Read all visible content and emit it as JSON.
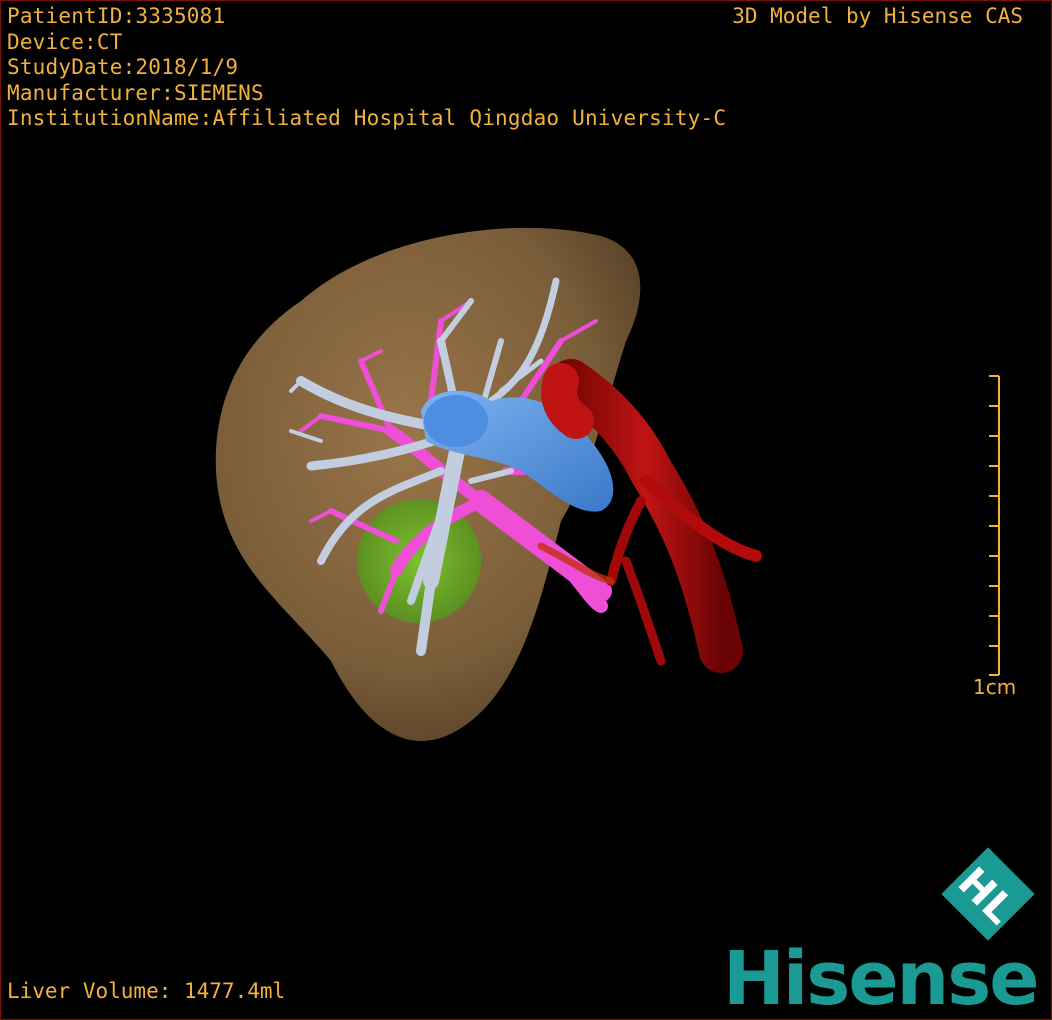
{
  "overlay": {
    "patient_id": "PatientID:3335081",
    "device": "Device:CT",
    "study_date": "StudyDate:2018/1/9",
    "manufacturer": "Manufacturer:SIEMENS",
    "institution": "InstitutionName:Affiliated Hospital Qingdao University-C",
    "credit": "3D Model by Hisense CAS",
    "liver_volume": "Liver Volume: 1477.4ml"
  },
  "scale_bar": {
    "label": "1cm",
    "color": "#f2b13a"
  },
  "brand": {
    "name": "Hisense",
    "logo_letters": "HL",
    "color": "#1a9a93"
  },
  "colors": {
    "text": "#f2b13a",
    "liver": "#8a6a43",
    "portal_vein": "#c3cde0",
    "hepatic_artery": "#ee4fd6",
    "ivc": "#5b9ae0",
    "aorta": "#b10b0b",
    "tumor": "#6fb52a",
    "border": "#7a1010"
  }
}
